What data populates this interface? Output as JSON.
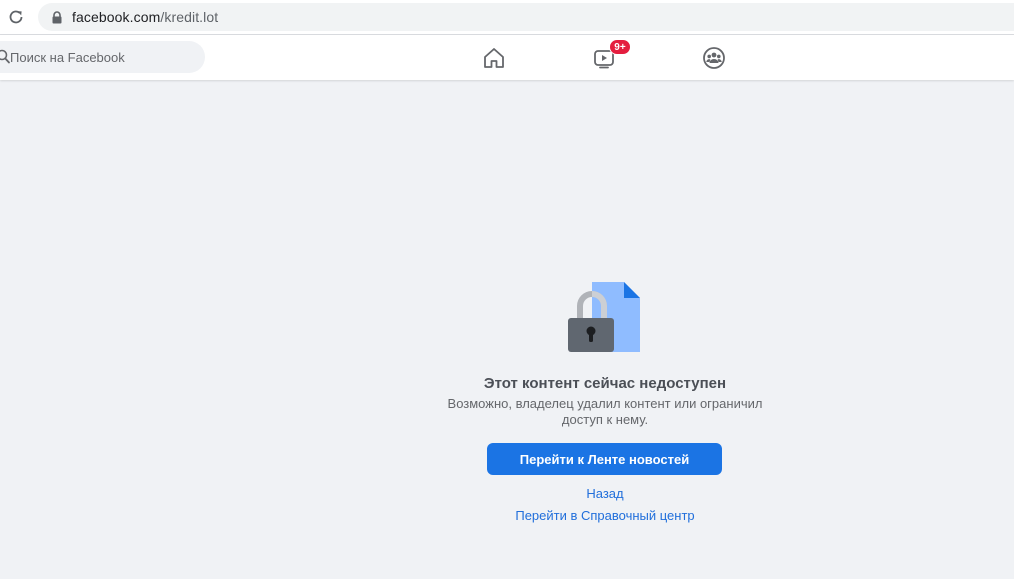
{
  "browser": {
    "url_host": "facebook.com",
    "url_path": "/kredit.lot"
  },
  "nav": {
    "search_placeholder": "Поиск на Facebook",
    "watch_badge": "9+"
  },
  "message": {
    "title": "Этот контент сейчас недоступен",
    "body": "Возможно, владелец удалил контент или ограничил доступ к нему.",
    "primary_button": "Перейти к Ленте новостей",
    "back_link": "Назад",
    "help_link": "Перейти в Справочный центр"
  },
  "colors": {
    "primary": "#1b74e4",
    "link": "#216fdb",
    "badge": "#e41e3f",
    "background": "#f0f2f5"
  },
  "icons": {
    "reload": "reload-icon",
    "lock": "lock-icon",
    "search": "search-icon",
    "home": "home-icon",
    "watch": "watch-icon",
    "groups": "groups-icon",
    "content_unavailable": "locked-document-icon"
  }
}
